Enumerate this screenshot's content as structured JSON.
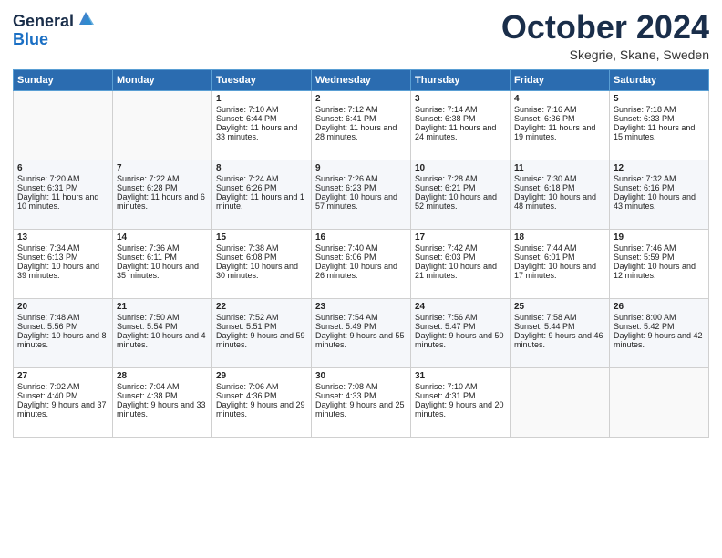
{
  "header": {
    "logo_line1": "General",
    "logo_line2": "Blue",
    "month": "October 2024",
    "location": "Skegrie, Skane, Sweden"
  },
  "days_of_week": [
    "Sunday",
    "Monday",
    "Tuesday",
    "Wednesday",
    "Thursday",
    "Friday",
    "Saturday"
  ],
  "weeks": [
    [
      {
        "day": "",
        "sunrise": "",
        "sunset": "",
        "daylight": ""
      },
      {
        "day": "",
        "sunrise": "",
        "sunset": "",
        "daylight": ""
      },
      {
        "day": "1",
        "sunrise": "Sunrise: 7:10 AM",
        "sunset": "Sunset: 6:44 PM",
        "daylight": "Daylight: 11 hours and 33 minutes."
      },
      {
        "day": "2",
        "sunrise": "Sunrise: 7:12 AM",
        "sunset": "Sunset: 6:41 PM",
        "daylight": "Daylight: 11 hours and 28 minutes."
      },
      {
        "day": "3",
        "sunrise": "Sunrise: 7:14 AM",
        "sunset": "Sunset: 6:38 PM",
        "daylight": "Daylight: 11 hours and 24 minutes."
      },
      {
        "day": "4",
        "sunrise": "Sunrise: 7:16 AM",
        "sunset": "Sunset: 6:36 PM",
        "daylight": "Daylight: 11 hours and 19 minutes."
      },
      {
        "day": "5",
        "sunrise": "Sunrise: 7:18 AM",
        "sunset": "Sunset: 6:33 PM",
        "daylight": "Daylight: 11 hours and 15 minutes."
      }
    ],
    [
      {
        "day": "6",
        "sunrise": "Sunrise: 7:20 AM",
        "sunset": "Sunset: 6:31 PM",
        "daylight": "Daylight: 11 hours and 10 minutes."
      },
      {
        "day": "7",
        "sunrise": "Sunrise: 7:22 AM",
        "sunset": "Sunset: 6:28 PM",
        "daylight": "Daylight: 11 hours and 6 minutes."
      },
      {
        "day": "8",
        "sunrise": "Sunrise: 7:24 AM",
        "sunset": "Sunset: 6:26 PM",
        "daylight": "Daylight: 11 hours and 1 minute."
      },
      {
        "day": "9",
        "sunrise": "Sunrise: 7:26 AM",
        "sunset": "Sunset: 6:23 PM",
        "daylight": "Daylight: 10 hours and 57 minutes."
      },
      {
        "day": "10",
        "sunrise": "Sunrise: 7:28 AM",
        "sunset": "Sunset: 6:21 PM",
        "daylight": "Daylight: 10 hours and 52 minutes."
      },
      {
        "day": "11",
        "sunrise": "Sunrise: 7:30 AM",
        "sunset": "Sunset: 6:18 PM",
        "daylight": "Daylight: 10 hours and 48 minutes."
      },
      {
        "day": "12",
        "sunrise": "Sunrise: 7:32 AM",
        "sunset": "Sunset: 6:16 PM",
        "daylight": "Daylight: 10 hours and 43 minutes."
      }
    ],
    [
      {
        "day": "13",
        "sunrise": "Sunrise: 7:34 AM",
        "sunset": "Sunset: 6:13 PM",
        "daylight": "Daylight: 10 hours and 39 minutes."
      },
      {
        "day": "14",
        "sunrise": "Sunrise: 7:36 AM",
        "sunset": "Sunset: 6:11 PM",
        "daylight": "Daylight: 10 hours and 35 minutes."
      },
      {
        "day": "15",
        "sunrise": "Sunrise: 7:38 AM",
        "sunset": "Sunset: 6:08 PM",
        "daylight": "Daylight: 10 hours and 30 minutes."
      },
      {
        "day": "16",
        "sunrise": "Sunrise: 7:40 AM",
        "sunset": "Sunset: 6:06 PM",
        "daylight": "Daylight: 10 hours and 26 minutes."
      },
      {
        "day": "17",
        "sunrise": "Sunrise: 7:42 AM",
        "sunset": "Sunset: 6:03 PM",
        "daylight": "Daylight: 10 hours and 21 minutes."
      },
      {
        "day": "18",
        "sunrise": "Sunrise: 7:44 AM",
        "sunset": "Sunset: 6:01 PM",
        "daylight": "Daylight: 10 hours and 17 minutes."
      },
      {
        "day": "19",
        "sunrise": "Sunrise: 7:46 AM",
        "sunset": "Sunset: 5:59 PM",
        "daylight": "Daylight: 10 hours and 12 minutes."
      }
    ],
    [
      {
        "day": "20",
        "sunrise": "Sunrise: 7:48 AM",
        "sunset": "Sunset: 5:56 PM",
        "daylight": "Daylight: 10 hours and 8 minutes."
      },
      {
        "day": "21",
        "sunrise": "Sunrise: 7:50 AM",
        "sunset": "Sunset: 5:54 PM",
        "daylight": "Daylight: 10 hours and 4 minutes."
      },
      {
        "day": "22",
        "sunrise": "Sunrise: 7:52 AM",
        "sunset": "Sunset: 5:51 PM",
        "daylight": "Daylight: 9 hours and 59 minutes."
      },
      {
        "day": "23",
        "sunrise": "Sunrise: 7:54 AM",
        "sunset": "Sunset: 5:49 PM",
        "daylight": "Daylight: 9 hours and 55 minutes."
      },
      {
        "day": "24",
        "sunrise": "Sunrise: 7:56 AM",
        "sunset": "Sunset: 5:47 PM",
        "daylight": "Daylight: 9 hours and 50 minutes."
      },
      {
        "day": "25",
        "sunrise": "Sunrise: 7:58 AM",
        "sunset": "Sunset: 5:44 PM",
        "daylight": "Daylight: 9 hours and 46 minutes."
      },
      {
        "day": "26",
        "sunrise": "Sunrise: 8:00 AM",
        "sunset": "Sunset: 5:42 PM",
        "daylight": "Daylight: 9 hours and 42 minutes."
      }
    ],
    [
      {
        "day": "27",
        "sunrise": "Sunrise: 7:02 AM",
        "sunset": "Sunset: 4:40 PM",
        "daylight": "Daylight: 9 hours and 37 minutes."
      },
      {
        "day": "28",
        "sunrise": "Sunrise: 7:04 AM",
        "sunset": "Sunset: 4:38 PM",
        "daylight": "Daylight: 9 hours and 33 minutes."
      },
      {
        "day": "29",
        "sunrise": "Sunrise: 7:06 AM",
        "sunset": "Sunset: 4:36 PM",
        "daylight": "Daylight: 9 hours and 29 minutes."
      },
      {
        "day": "30",
        "sunrise": "Sunrise: 7:08 AM",
        "sunset": "Sunset: 4:33 PM",
        "daylight": "Daylight: 9 hours and 25 minutes."
      },
      {
        "day": "31",
        "sunrise": "Sunrise: 7:10 AM",
        "sunset": "Sunset: 4:31 PM",
        "daylight": "Daylight: 9 hours and 20 minutes."
      },
      {
        "day": "",
        "sunrise": "",
        "sunset": "",
        "daylight": ""
      },
      {
        "day": "",
        "sunrise": "",
        "sunset": "",
        "daylight": ""
      }
    ]
  ]
}
